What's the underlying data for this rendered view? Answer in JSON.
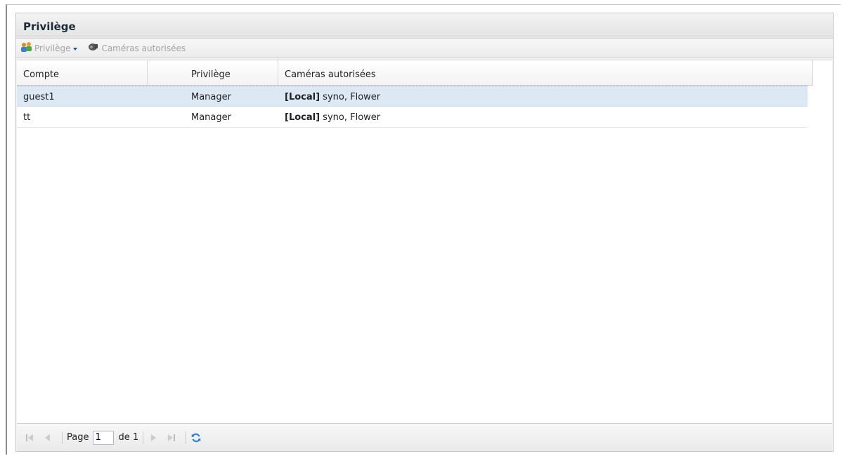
{
  "panel": {
    "title": "Privilège"
  },
  "toolbar": {
    "privilege_label": "Privilège",
    "cameras_label": "Caméras autorisées"
  },
  "grid": {
    "columns": [
      "Compte",
      "Privilège",
      "Caméras autorisées"
    ],
    "rows": [
      {
        "compte": "guest1",
        "privilege": "Manager",
        "cams_prefix": "[Local]",
        "cams_rest": " syno, Flower",
        "selected": true
      },
      {
        "compte": "tt",
        "privilege": "Manager",
        "cams_prefix": "[Local]",
        "cams_rest": " syno, Flower",
        "selected": false
      }
    ]
  },
  "pager": {
    "page_label": "Page",
    "page_value": "1",
    "of_label": "de 1"
  },
  "colors": {
    "selected_row": "#dde8f5",
    "refresh_icon": "#2f7fd1"
  }
}
